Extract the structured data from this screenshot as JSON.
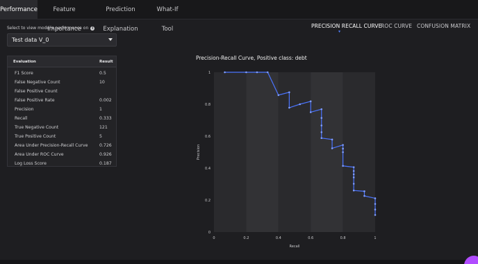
{
  "tabs": [
    "Performance",
    "Feature Importance",
    "Prediction Explanation",
    "What-If Tool"
  ],
  "view_selector": {
    "label": "Select to view model's performance on",
    "value": "Test data V_0"
  },
  "metrics": {
    "headers": [
      "Evaluation",
      "Result"
    ],
    "rows": [
      [
        "F1 Score",
        "0.5"
      ],
      [
        "False Negative Count",
        "10"
      ],
      [
        "False Positive Count",
        ""
      ],
      [
        "False Positive Rate",
        "0.002"
      ],
      [
        "Precision",
        "1"
      ],
      [
        "Recall",
        "0.333"
      ],
      [
        "True Negative Count",
        "121"
      ],
      [
        "True Positive Count",
        "5"
      ],
      [
        "Area Under Precision-Recall Curve",
        "0.726"
      ],
      [
        "Area Under ROC Curve",
        "0.926"
      ],
      [
        "Log Loss Score",
        "0.187"
      ]
    ]
  },
  "chart_tabs": [
    "PRECISION RECALL CURVE",
    "ROC CURVE",
    "CONFUSION MATRIX"
  ],
  "colors": {
    "line": "#4a74ff",
    "accent": "#4f7dff",
    "fab": "#b14cff"
  },
  "chart_data": {
    "type": "line",
    "title": "Precision-Recall Curve, Positive class: debt",
    "xlabel": "Recall",
    "ylabel": "Precision",
    "xlim": [
      0,
      1
    ],
    "ylim": [
      0,
      1
    ],
    "x_ticks": [
      "0",
      "0.2",
      "0.4",
      "0.6",
      "0.8",
      "1"
    ],
    "y_ticks": [
      "0",
      "0.2",
      "0.4",
      "0.6",
      "0.8",
      "1"
    ],
    "points": [
      [
        0.067,
        1.0
      ],
      [
        0.2,
        1.0
      ],
      [
        0.267,
        1.0
      ],
      [
        0.333,
        1.0
      ],
      [
        0.4,
        0.857
      ],
      [
        0.467,
        0.875
      ],
      [
        0.467,
        0.778
      ],
      [
        0.533,
        0.8
      ],
      [
        0.6,
        0.818
      ],
      [
        0.6,
        0.75
      ],
      [
        0.667,
        0.769
      ],
      [
        0.667,
        0.714
      ],
      [
        0.667,
        0.667
      ],
      [
        0.667,
        0.625
      ],
      [
        0.667,
        0.588
      ],
      [
        0.733,
        0.579
      ],
      [
        0.733,
        0.524
      ],
      [
        0.8,
        0.545
      ],
      [
        0.8,
        0.522
      ],
      [
        0.8,
        0.5
      ],
      [
        0.8,
        0.414
      ],
      [
        0.867,
        0.406
      ],
      [
        0.867,
        0.382
      ],
      [
        0.867,
        0.361
      ],
      [
        0.867,
        0.342
      ],
      [
        0.867,
        0.302
      ],
      [
        0.867,
        0.26
      ],
      [
        0.933,
        0.255
      ],
      [
        0.933,
        0.226
      ],
      [
        1.0,
        0.211
      ],
      [
        1.0,
        0.176
      ],
      [
        1.0,
        0.141
      ],
      [
        1.0,
        0.107
      ]
    ]
  }
}
